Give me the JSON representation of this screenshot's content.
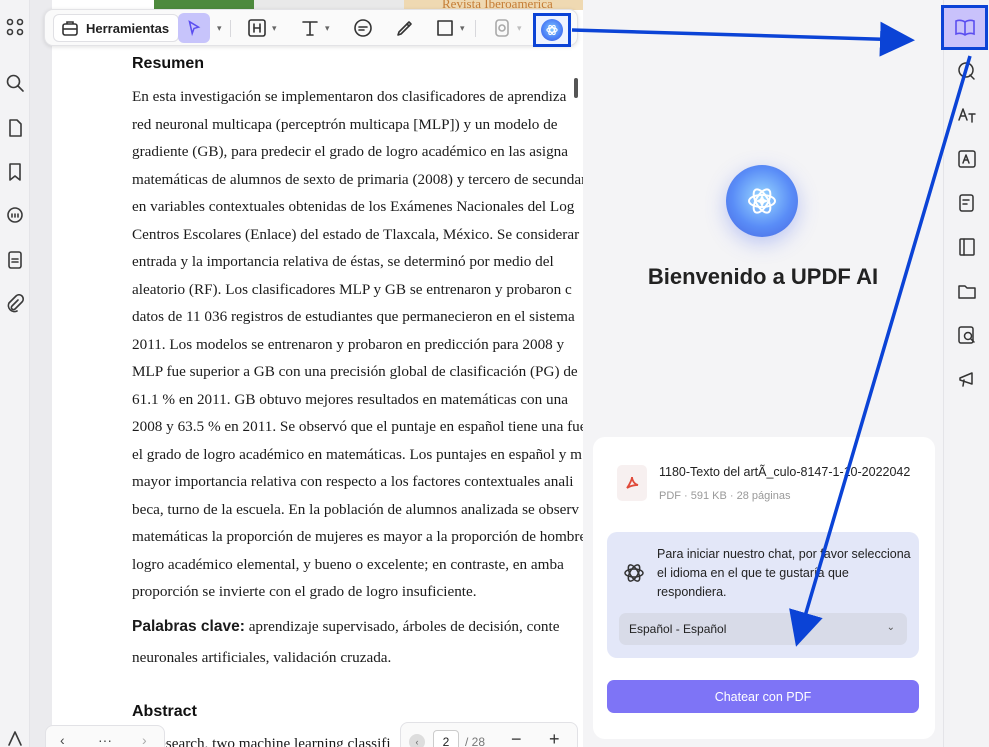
{
  "toolbar": {
    "tools_label": "Herramientas"
  },
  "document": {
    "header_text": "Revista Iberoamerica",
    "resumen_heading": "Resumen",
    "resumen_lines": [
      "En esta investigación se implementaron dos clasificadores de aprendiza",
      "red neuronal multicapa (perceptrón multicapa [MLP]) y un modelo de",
      "gradiente (GB), para predecir el grado de logro académico en las asigna",
      "matemáticas de alumnos de sexto de primaria (2008) y tercero de secundar",
      "en variables contextuales obtenidas de los Exámenes Nacionales del Log",
      "Centros Escolares (Enlace) del estado de Tlaxcala, México. Se considerar",
      "entrada y la importancia relativa de éstas, se determinó por medio del",
      "aleatorio (RF). Los clasificadores MLP y GB se entrenaron y probaron c",
      "datos de 11 036 registros de estudiantes que permanecieron en el sistema",
      "2011. Los modelos se entrenaron y probaron en predicción para 2008 y",
      "MLP fue superior a GB con una precisión global de clasificación (PG) de",
      "61.1 % en 2011. GB obtuvo mejores resultados en matemáticas con una",
      "2008 y 63.5 % en 2011. Se observó que el puntaje en español tiene una fue",
      "el grado de logro académico en matemáticas. Los puntajes en español y m",
      "mayor importancia relativa con respecto a los factores contextuales anali",
      "beca, turno de la escuela. En la población de alumnos analizada se observ",
      "matemáticas la proporción de mujeres es mayor a la proporción de hombre",
      "logro académico elemental, y bueno o excelente; en contraste, en amba",
      "proporción se invierte con el grado de logro insuficiente."
    ],
    "keywords_label": "Palabras clave:",
    "keywords_line1": " aprendizaje supervisado, árboles de decisión, conte",
    "keywords_line2": "neuronales artificiales, validación cruzada.",
    "abstract_heading": "Abstract",
    "abstract_line1": "research, two machine learning classifi"
  },
  "pagination": {
    "current_page": "2",
    "total_pages": "/ 28",
    "zoom_out": "−",
    "zoom_in": "+",
    "more": "···"
  },
  "ai_panel": {
    "welcome_title": "Bienvenido a UPDF AI",
    "file_name": "1180-Texto del artÃ_culo-8147-1-10-2022042",
    "file_meta": "PDF · 591 KB · 28 páginas",
    "language_prompt": "Para iniciar nuestro chat, por favor selecciona el idioma en el que te gustaría que respondiera.",
    "language_selected": "Español - Español",
    "chat_button": "Chatear con PDF"
  },
  "colors": {
    "accent": "#7e74f6",
    "highlight_annotation": "#0b43d6",
    "selected_tool_bg": "#c7c4fb"
  }
}
